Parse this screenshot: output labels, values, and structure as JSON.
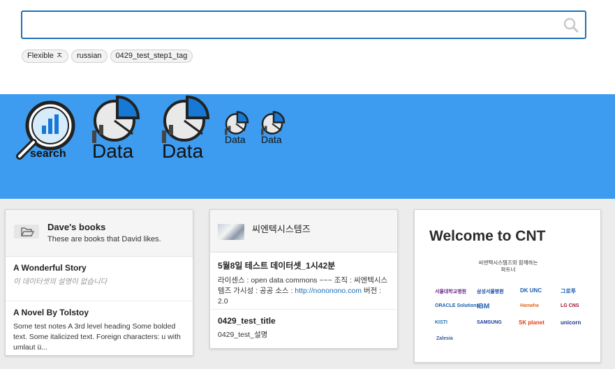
{
  "search": {
    "placeholder": "",
    "value": ""
  },
  "tags": [
    "Flexible ㅈ",
    "russian",
    "0429_test_step1_tag"
  ],
  "banner": {
    "icons": [
      {
        "label": "search"
      },
      {
        "label": "Data"
      },
      {
        "label": "Data"
      },
      {
        "label": "Data"
      },
      {
        "label": "Data"
      }
    ]
  },
  "colors": {
    "accent": "#3d9cef",
    "search_border": "#1f6fb5",
    "link": "#1a6db5"
  },
  "cards": {
    "daves_books": {
      "title": "Dave's books",
      "subtitle": "These are books that David likes.",
      "items": [
        {
          "title": "A Wonderful Story",
          "desc": "이 데이터셋의 설명이 없습니다"
        },
        {
          "title": "A Novel By Tolstoy",
          "desc": "Some test notes A 3rd level heading Some bolded text. Some italicized text. Foreign characters: u with umlaut ü..."
        }
      ]
    },
    "cnt": {
      "title": "씨엔텍시스템즈",
      "items": [
        {
          "title": "5월8일 테스트 데이터셋_1시42분",
          "desc_before": "라이센스 : open data commons ~~~ 조직 : 씨엔텍시스템즈 가시성 : 공공 소스 : ",
          "link": "http://nononono.com",
          "desc_after": " 버전 : 2.0"
        },
        {
          "title": "0429_test_title",
          "desc": "0429_test_설명"
        }
      ]
    },
    "welcome": {
      "title": "Welcome to CNT",
      "subtitle_line1": "씨엔텍시스템즈와 함께하는",
      "subtitle_line2": "파트너",
      "partners": [
        "서울대학교병원",
        "삼성서울병원",
        "DK UNC",
        "그로투",
        "ORACLE Solutions",
        "IBM",
        "Hanwha",
        "LG CNS",
        "KISTI",
        "SAMSUNG",
        "SK planet",
        "unicorn",
        "Zalesia"
      ]
    }
  }
}
